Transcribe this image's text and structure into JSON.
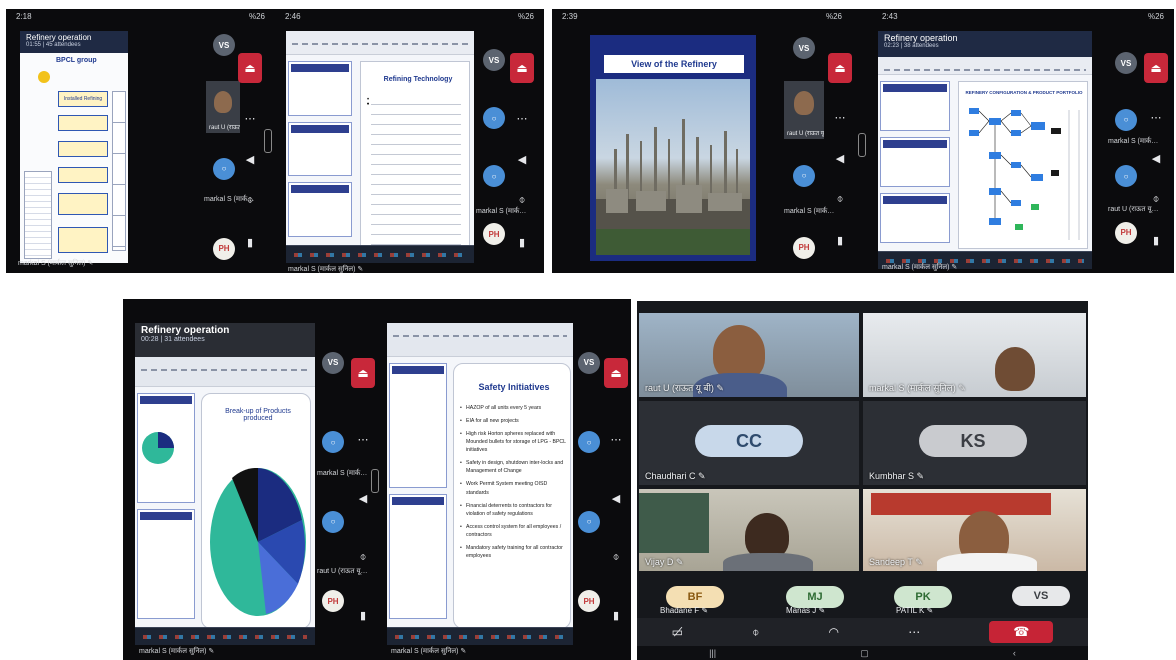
{
  "shots": {
    "top_left": {
      "status_time_a": "2:18",
      "status_time_b": "2:46",
      "status_right": "%26",
      "meeting_title": "Refinery operation",
      "meeting_sub": "01:55 | 45 attendees",
      "slide_group_title": "BPCL group",
      "slide_integration_box": "Installed Refining",
      "slide2_title": "Refining Technology",
      "caption": "markal S (मार्कल सुनिल) ✎",
      "side_caption_1": "raut U (राऊत यू…",
      "side_caption_2": "markal S (मार्क…"
    },
    "top_right": {
      "status_time_a": "2:39",
      "status_time_b": "2:43",
      "status_right": "%26",
      "slide_title": "View of the Refinery",
      "meeting_title": "Refinery operation",
      "meeting_sub": "02:23 | 38 attendees",
      "slide2_title": "REFINERY CONFIGURATION & PRODUCT PORTFOLIO",
      "caption": "markal S (मार्कल सुनिल) ✎",
      "side_caption_1": "raut U (राऊत यू…",
      "side_caption_2": "markal S (मार्क…",
      "side_caption_3": "raut U (राऊत यू…"
    },
    "bottom_left": {
      "meeting_title": "Refinery operation",
      "meeting_sub": "00:28 | 31 attendees",
      "slide_title": "Break-up of Products produced",
      "slide2_title": "Safety Initiatives",
      "safety_points": [
        "HAZOP of all units every 5 years",
        "EIA for all new projects",
        "High risk Horton spheres replaced with Mounded bullets for storage of LPG - BPCL initiatives",
        "Safety in design, shutdown inter-locks and Management of Change",
        "Work Permit System meeting OISD standards",
        "Financial deterrents to contractors for violation of safety regulations",
        "Access control system for all employees / contractors",
        "Mandatory safety training for all contractor employees"
      ],
      "caption": "markal S (मार्कल सुनिल) ✎",
      "side_caption_1": "markal S (मार्क…",
      "side_caption_2": "raut U (राऊत यू…"
    }
  },
  "avatars": {
    "vs": "VS",
    "ph": "PH"
  },
  "meet": {
    "tiles": [
      {
        "name": "raut U (राऊत यू बी) ✎"
      },
      {
        "name": "markal S (मार्कल सुनिल) ✎"
      },
      {
        "name": "Chaudhari C ✎",
        "initials": "CC"
      },
      {
        "name": "Kumbhar S ✎",
        "initials": "KS"
      },
      {
        "name": "Vijay D ✎"
      },
      {
        "name": "Sandeep T ✎"
      }
    ],
    "chips": [
      {
        "initials": "BF",
        "label": "Bhadane F ✎",
        "color": "#f4dfb3",
        "text": "#8a5a12"
      },
      {
        "initials": "MJ",
        "label": "Manas J ✎",
        "color": "#cfe6cf",
        "text": "#2e6b33"
      },
      {
        "initials": "PK",
        "label": "PATIL K ✎",
        "color": "#cfe6cf",
        "text": "#2e6b33"
      },
      {
        "initials": "VS",
        "label": "",
        "color": "#e7e8ea",
        "text": "#3a3d42"
      }
    ],
    "controls": [
      "video-off",
      "mic-off",
      "headset",
      "more",
      "hang-up"
    ]
  },
  "colors": {
    "hangup": "#c8283a",
    "slide_blue": "#203a8f",
    "accent_teal": "#2fb89a"
  }
}
